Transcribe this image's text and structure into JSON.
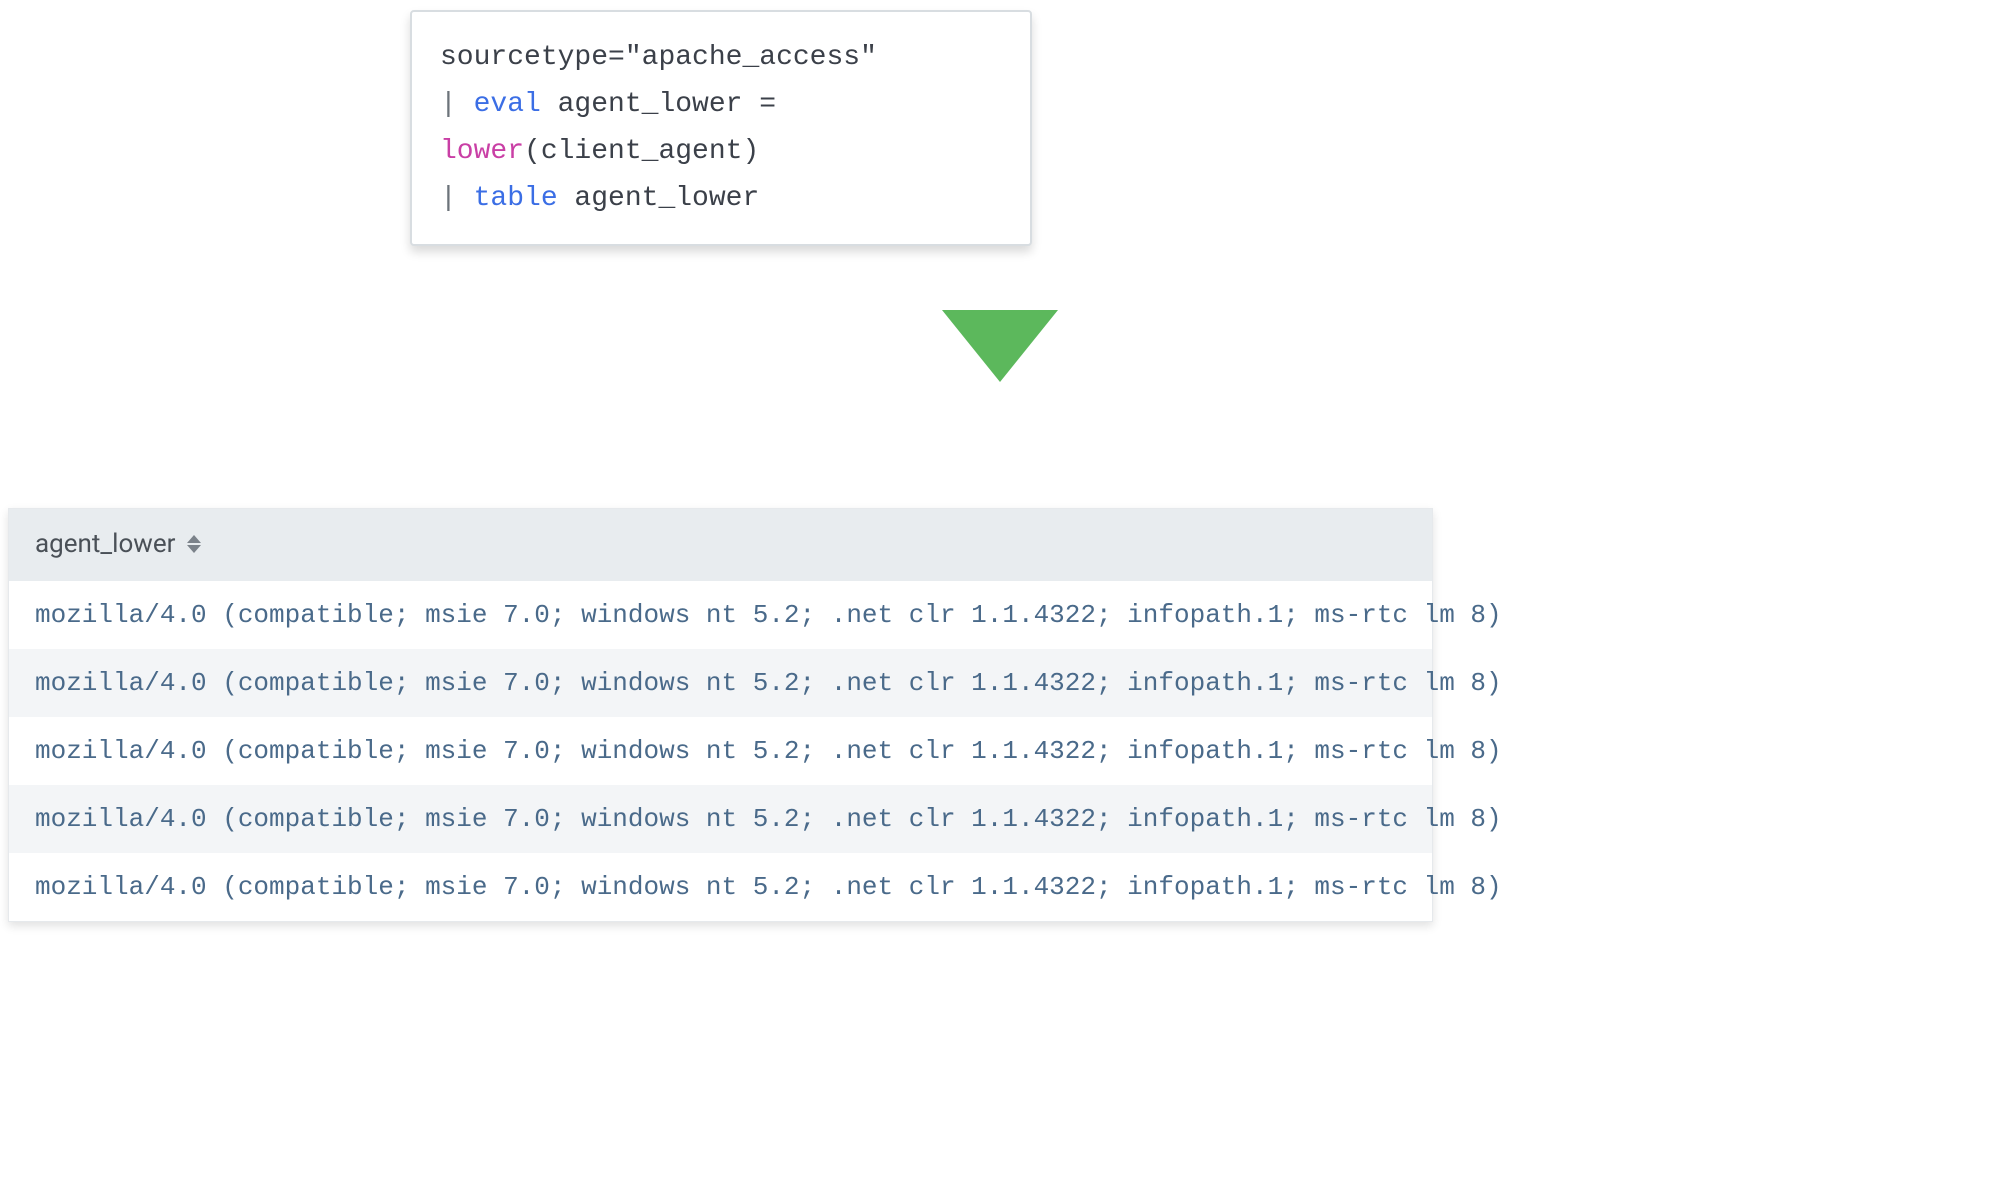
{
  "query": {
    "line1_prefix": "sourcetype=",
    "line1_value": "\"apache_access\"",
    "line2_cmd": "eval",
    "line2_assign_lhs": " agent_lower = ",
    "line2_func": "lower",
    "line2_args": "(client_agent)",
    "line3_cmd": "table",
    "line3_rest": " agent_lower",
    "pipe": "| "
  },
  "results": {
    "header": "agent_lower",
    "rows": [
      "mozilla/4.0 (compatible; msie 7.0; windows nt 5.2; .net clr 1.1.4322; infopath.1; ms-rtc lm 8)",
      "mozilla/4.0 (compatible; msie 7.0; windows nt 5.2; .net clr 1.1.4322; infopath.1; ms-rtc lm 8)",
      "mozilla/4.0 (compatible; msie 7.0; windows nt 5.2; .net clr 1.1.4322; infopath.1; ms-rtc lm 8)",
      "mozilla/4.0 (compatible; msie 7.0; windows nt 5.2; .net clr 1.1.4322; infopath.1; ms-rtc lm 8)",
      "mozilla/4.0 (compatible; msie 7.0; windows nt 5.2; .net clr 1.1.4322; infopath.1; ms-rtc lm 8)"
    ]
  },
  "colors": {
    "cmd": "#3b6ee5",
    "func": "#c93fa5",
    "arrow": "#5cb85c",
    "row_text": "#4a6a8a"
  }
}
